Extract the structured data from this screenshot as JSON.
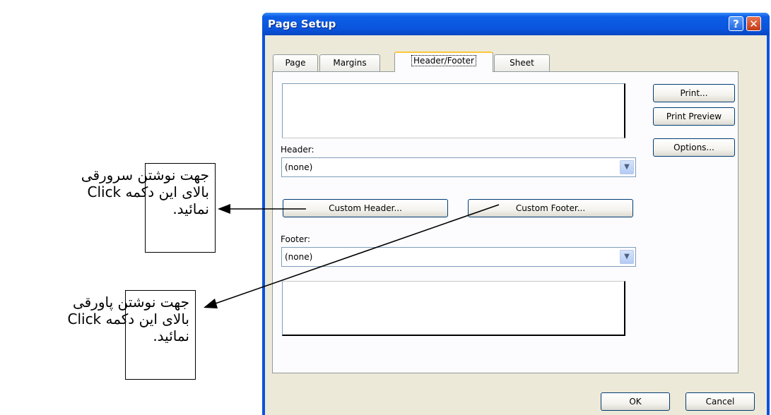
{
  "dialog": {
    "title": "Page Setup",
    "help_label": "?",
    "close_label": "✕"
  },
  "tabs": [
    {
      "label": "Page"
    },
    {
      "label": "Margins"
    },
    {
      "label": "Header/Footer",
      "active": true
    },
    {
      "label": "Sheet"
    }
  ],
  "header": {
    "label": "Header:",
    "value": "(none)",
    "custom_button": "Custom Header..."
  },
  "footer": {
    "label": "Footer:",
    "value": "(none)",
    "custom_button": "Custom Footer..."
  },
  "side_buttons": {
    "print": "Print...",
    "print_preview": "Print Preview",
    "options": "Options..."
  },
  "bottom_buttons": {
    "ok": "OK",
    "cancel": "Cancel"
  },
  "annotations": {
    "header_note": [
      "جهت نوشتن سرورقی",
      "بالای این دکمه Click",
      "نمائید."
    ],
    "footer_note": [
      "جهت نوشتن پاورقی",
      "بالای این دکمه Click",
      "نمائید."
    ]
  },
  "icons": {
    "dropdown": "chevron-down-icon",
    "help": "question-icon",
    "close": "close-icon"
  },
  "colors": {
    "titlebar": "#0a55dd",
    "dialog_face": "#ece9d8",
    "active_tab_accent": "#ffc83c"
  }
}
